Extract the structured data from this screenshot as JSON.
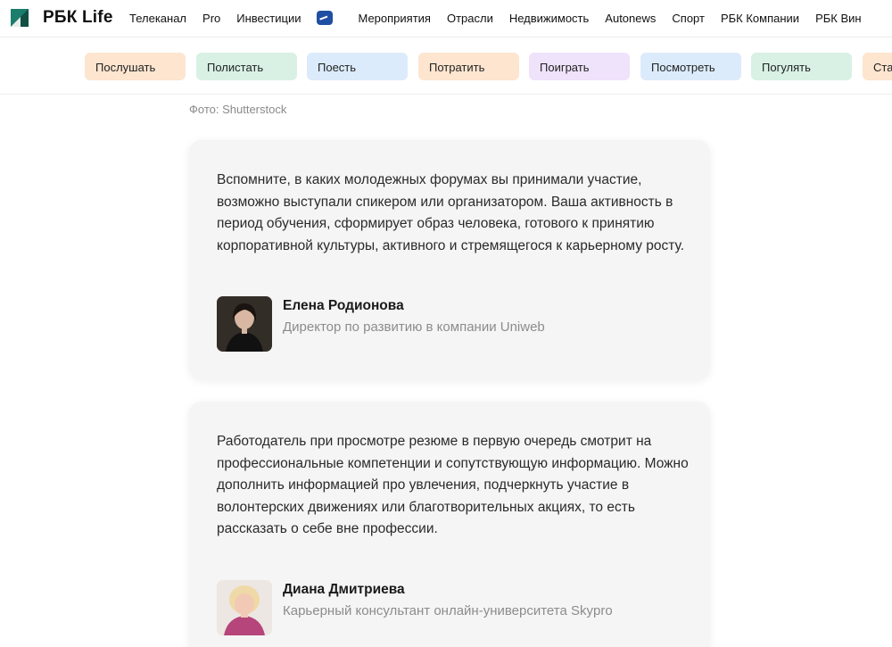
{
  "header": {
    "logo": "РБК Life",
    "nav": [
      "Телеканал",
      "Pro",
      "Инвестиции",
      "Мероприятия",
      "Отрасли",
      "Недвижимость",
      "Autonews",
      "Спорт",
      "РБК Компании",
      "РБК Вин"
    ]
  },
  "categories": [
    {
      "label": "Послушать",
      "color": "#fde5cf"
    },
    {
      "label": "Полистать",
      "color": "#d8f1e4"
    },
    {
      "label": "Поесть",
      "color": "#dcebfb"
    },
    {
      "label": "Потратить",
      "color": "#fde5cf"
    },
    {
      "label": "Поиграть",
      "color": "#efe2fb"
    },
    {
      "label": "Посмотреть",
      "color": "#dcebfb"
    },
    {
      "label": "Погулять",
      "color": "#d8f1e4"
    },
    {
      "label": "Ста",
      "color": "#fde5cf"
    }
  ],
  "photo_caption": "Фото: Shutterstock",
  "quotes": [
    {
      "text": "Вспомните, в каких молодежных форумах вы принимали участие, возможно выступали спикером или организатором. Ваша активность в период обучения, сформирует образ человека, готового к принятию корпоративной культуры, активного и стремящегося к карьерному росту.",
      "name": "Елена Родионова",
      "role": "Директор по развитию в компании Uniweb"
    },
    {
      "text": "Работодатель при просмотре резюме в первую очередь смотрит на профессиональные компетенции и сопутствующую информацию. Можно дополнить информацией про увлечения, подчеркнуть участие в волонтерских движениях или благотворительных акциях, то есть рассказать о себе вне профессии.",
      "name": "Диана Дмитриева",
      "role": "Карьерный консультант онлайн-университета Skypro"
    }
  ]
}
